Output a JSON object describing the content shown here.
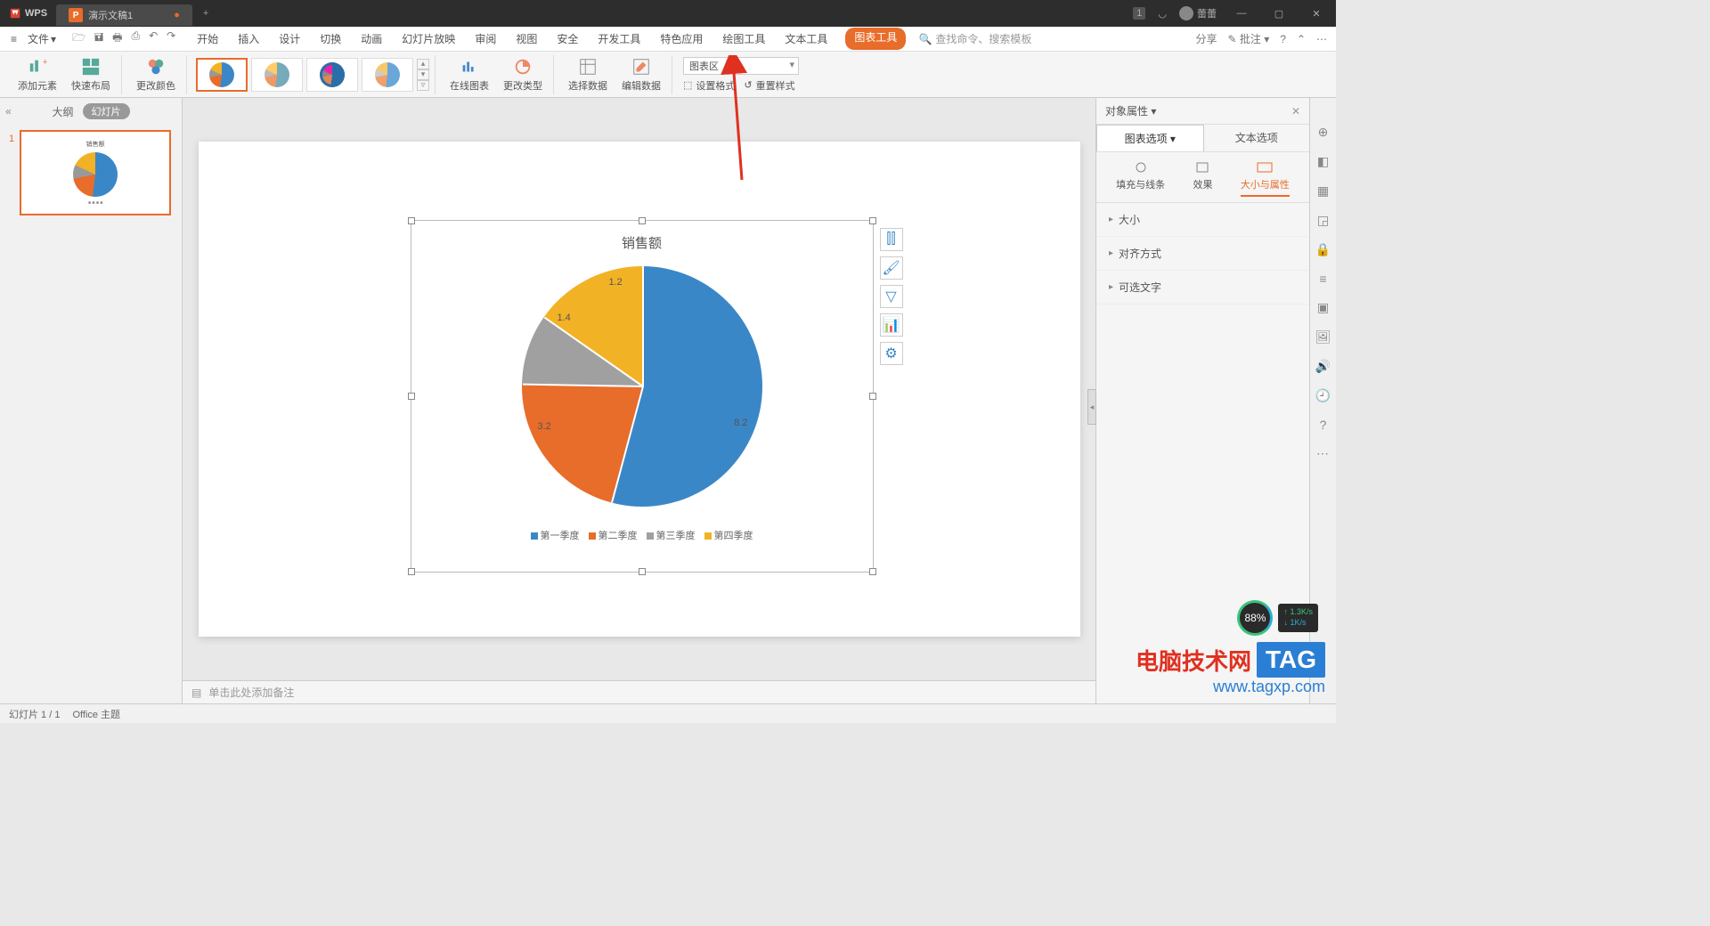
{
  "titlebar": {
    "app": "WPS",
    "doc_tab": "演示文稿1",
    "badge": "1",
    "user": "蕾蕾"
  },
  "menubar": {
    "file": "文件",
    "tabs": [
      "开始",
      "插入",
      "设计",
      "切换",
      "动画",
      "幻灯片放映",
      "审阅",
      "视图",
      "安全",
      "开发工具",
      "特色应用",
      "绘图工具",
      "文本工具"
    ],
    "active_tab": "图表工具",
    "search_placeholder": "查找命令、搜索模板",
    "share": "分享",
    "annotate": "批注"
  },
  "ribbon": {
    "add_element": "添加元素",
    "quick_layout": "快速布局",
    "change_color": "更改颜色",
    "online_chart": "在线图表",
    "change_type": "更改类型",
    "select_data": "选择数据",
    "edit_data": "编辑数据",
    "chart_area_combo": "图表区",
    "set_format": "设置格式",
    "reset_style": "重置样式"
  },
  "side": {
    "outline": "大纲",
    "slides": "幻灯片",
    "slide_num": "1"
  },
  "chart_data": {
    "type": "pie",
    "title": "销售额",
    "categories": [
      "第一季度",
      "第二季度",
      "第三季度",
      "第四季度"
    ],
    "values": [
      8.2,
      3.2,
      1.4,
      1.2
    ],
    "colors": [
      "#3a87c8",
      "#e86c2a",
      "#a0a0a0",
      "#f2b225"
    ],
    "data_labels": [
      "8.2",
      "3.2",
      "1.4",
      "1.2"
    ]
  },
  "prop_panel": {
    "title": "对象属性",
    "tab_chart": "图表选项",
    "tab_text": "文本选项",
    "sub_fill": "填充与线条",
    "sub_effect": "效果",
    "sub_size": "大小与属性",
    "sec_size": "大小",
    "sec_align": "对齐方式",
    "sec_alttext": "可选文字"
  },
  "notes": {
    "placeholder": "单击此处添加备注"
  },
  "status": {
    "page": "幻灯片 1 / 1",
    "theme": "Office 主题"
  },
  "speed": {
    "pct": "88%",
    "up": "1.3K/s",
    "dn": "1K/s"
  },
  "watermark": {
    "line1": "电脑技术网",
    "tag": "TAG",
    "line2": "www.tagxp.com"
  }
}
